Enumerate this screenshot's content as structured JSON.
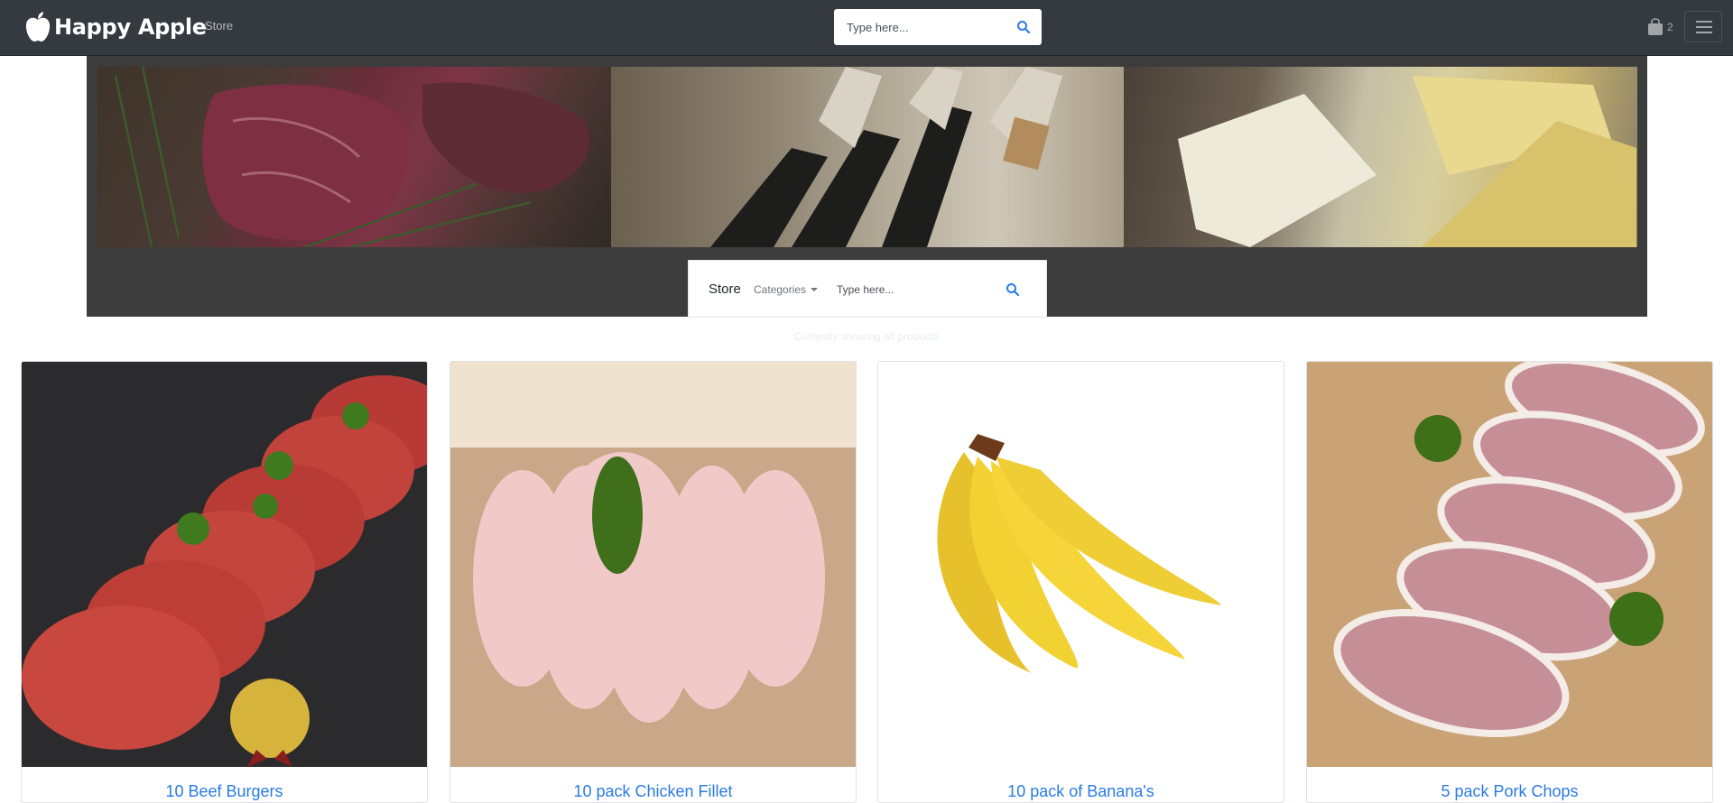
{
  "navbar": {
    "brand": "Happy Apple",
    "store_link": "Store",
    "search_placeholder": "Type here...",
    "cart_count": "2"
  },
  "store_bar": {
    "title": "Store",
    "categories": "Categories",
    "search_placeholder": "Type here..."
  },
  "showing_text": "Currently showing all products",
  "products": [
    {
      "title": "10 Beef Burgers"
    },
    {
      "title": "10 pack Chicken Fillet"
    },
    {
      "title": "10 pack of Banana's"
    },
    {
      "title": "5 pack Pork Chops"
    }
  ],
  "colors": {
    "navbar": "#343a40",
    "hero": "#3c3c3c",
    "link": "#2a7be4",
    "search_icon": "#2a7be4"
  },
  "icons": {
    "brand": "apple-icon",
    "search": "search-icon",
    "cart": "shopping-bag-icon",
    "menu": "hamburger-menu-icon"
  }
}
